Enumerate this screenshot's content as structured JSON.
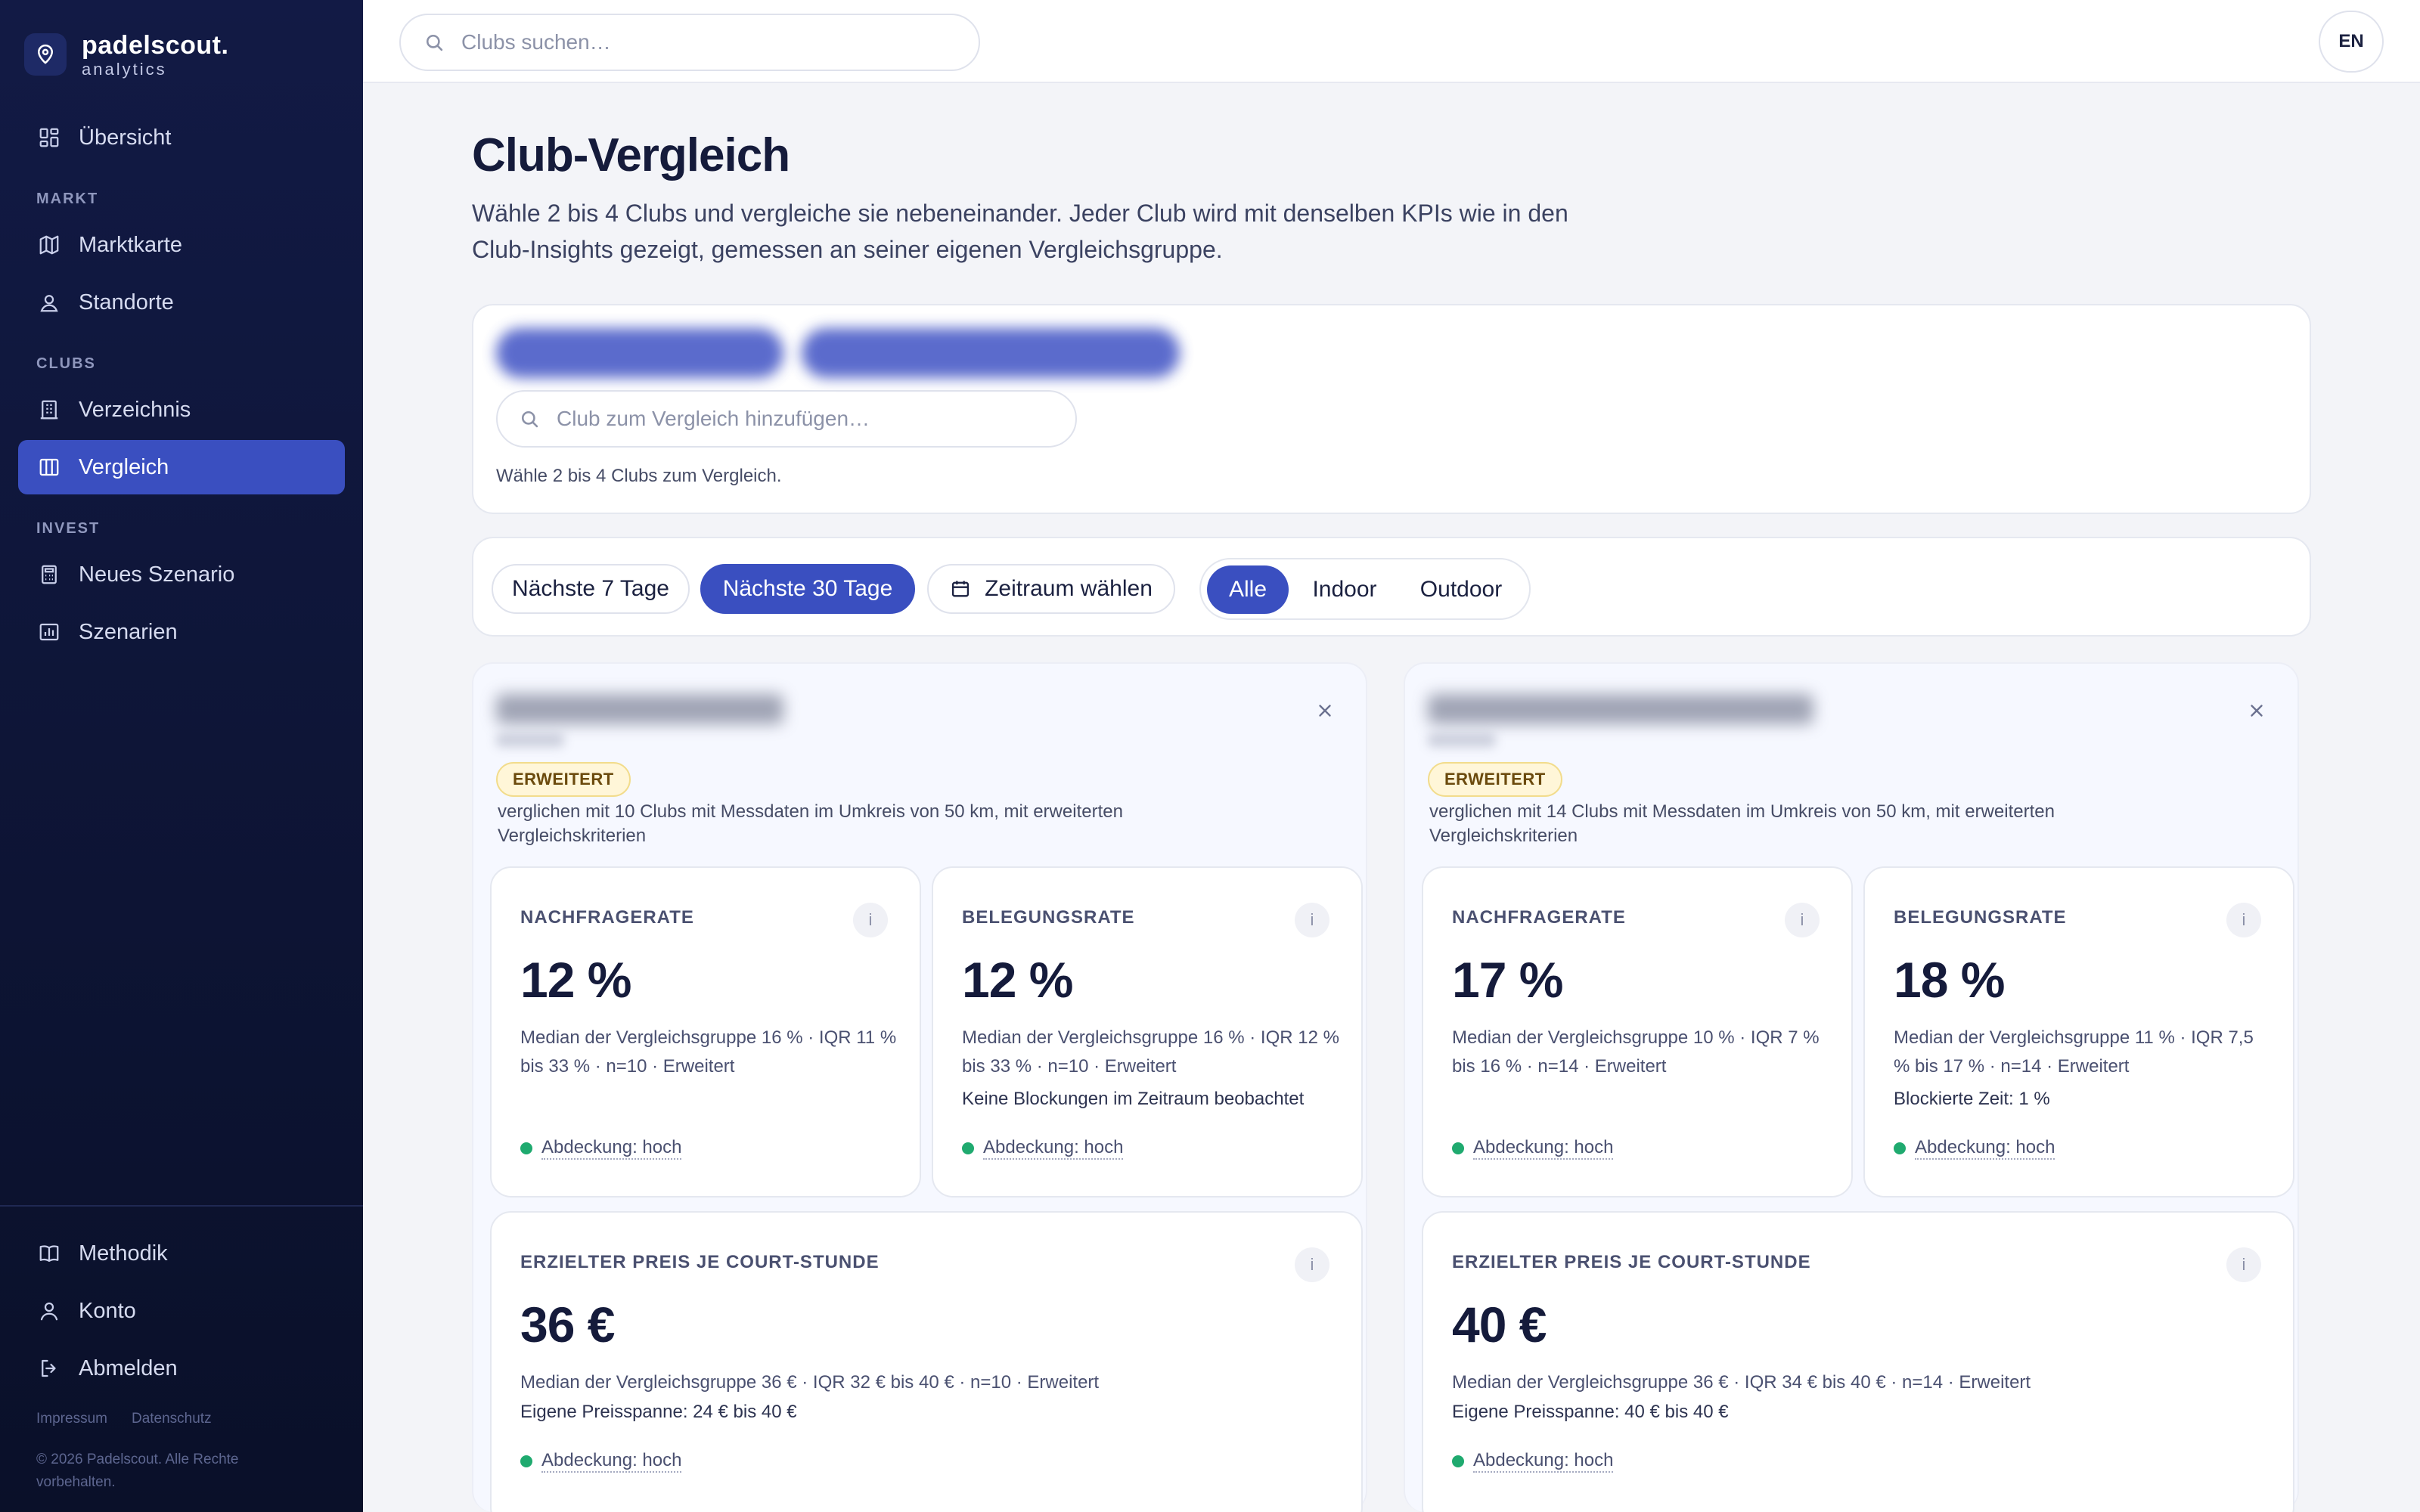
{
  "brand": {
    "name": "padelscout.",
    "sub": "analytics"
  },
  "sidebar": {
    "overview": "Übersicht",
    "sections": {
      "markt": "MARKT",
      "clubs": "CLUBS",
      "invest": "INVEST"
    },
    "items": [
      {
        "label": "Marktkarte"
      },
      {
        "label": "Standorte"
      },
      {
        "label": "Verzeichnis"
      },
      {
        "label": "Vergleich"
      },
      {
        "label": "Neues Szenario"
      },
      {
        "label": "Szenarien"
      }
    ],
    "bottom": [
      {
        "label": "Methodik"
      },
      {
        "label": "Konto"
      },
      {
        "label": "Abmelden"
      }
    ],
    "legal": {
      "impressum": "Impressum",
      "datenschutz": "Datenschutz"
    },
    "copyright": "© 2026 Padelscout. Alle Rechte vorbehalten."
  },
  "topbar": {
    "search_placeholder": "Clubs suchen…",
    "lang": "EN"
  },
  "page": {
    "title": "Club-Vergleich",
    "description": "Wähle 2 bis 4 Clubs und vergleiche sie nebeneinander. Jeder Club wird mit denselben KPIs wie in den Club-Insights gezeigt, gemessen an seiner eigenen Vergleichsgruppe."
  },
  "picker": {
    "placeholder": "Club zum Vergleich hinzufügen…",
    "hint": "Wähle 2 bis 4 Clubs zum Vergleich."
  },
  "filters": {
    "range": [
      "Nächste 7 Tage",
      "Nächste 30 Tage"
    ],
    "custom": "Zeitraum wählen",
    "types": [
      "Alle",
      "Indoor",
      "Outdoor"
    ]
  },
  "clubs": [
    {
      "badge": "ERWEITERT",
      "comparison": "verglichen mit 10 Clubs mit Messdaten im Umkreis von 50 km, mit erweiterten Vergleichskriterien",
      "kpis": {
        "demand": {
          "label": "NACHFRAGERATE",
          "value": "12 %",
          "median": "Median der Vergleichsgruppe 16 % · IQR 11 % bis 33 % · n=10 · Erweitert",
          "extra": "",
          "coverage": "Abdeckung: hoch"
        },
        "occupancy": {
          "label": "BELEGUNGSRATE",
          "value": "12 %",
          "median": "Median der Vergleichsgruppe 16 % · IQR 12 % bis 33 % · n=10 · Erweitert",
          "extra": "Keine Blockungen im Zeitraum beobachtet",
          "coverage": "Abdeckung: hoch"
        },
        "price": {
          "label": "ERZIELTER PREIS JE COURT-STUNDE",
          "value": "36 €",
          "median": "Median der Vergleichsgruppe 36 € · IQR 32 € bis 40 € · n=10 · Erweitert",
          "extra": "Eigene Preisspanne: 24 € bis 40 €",
          "coverage": "Abdeckung: hoch"
        }
      }
    },
    {
      "badge": "ERWEITERT",
      "comparison": "verglichen mit 14 Clubs mit Messdaten im Umkreis von 50 km, mit erweiterten Vergleichskriterien",
      "kpis": {
        "demand": {
          "label": "NACHFRAGERATE",
          "value": "17 %",
          "median": "Median der Vergleichsgruppe 10 % · IQR 7 % bis 16 % · n=14 · Erweitert",
          "extra": "",
          "coverage": "Abdeckung: hoch"
        },
        "occupancy": {
          "label": "BELEGUNGSRATE",
          "value": "18 %",
          "median": "Median der Vergleichsgruppe 11 % · IQR 7,5 % bis 17 % · n=14 · Erweitert",
          "extra": "Blockierte Zeit: 1 %",
          "coverage": "Abdeckung: hoch"
        },
        "price": {
          "label": "ERZIELTER PREIS JE COURT-STUNDE",
          "value": "40 €",
          "median": "Median der Vergleichsgruppe 36 € · IQR 34 € bis 40 € · n=14 · Erweitert",
          "extra": "Eigene Preisspanne: 40 € bis 40 €",
          "coverage": "Abdeckung: hoch"
        }
      }
    }
  ],
  "colors": {
    "accent": "#3a4fc0",
    "sidebar": "#0d1434",
    "coverage_high": "#1faa6f"
  },
  "icons": {
    "info": "i"
  }
}
